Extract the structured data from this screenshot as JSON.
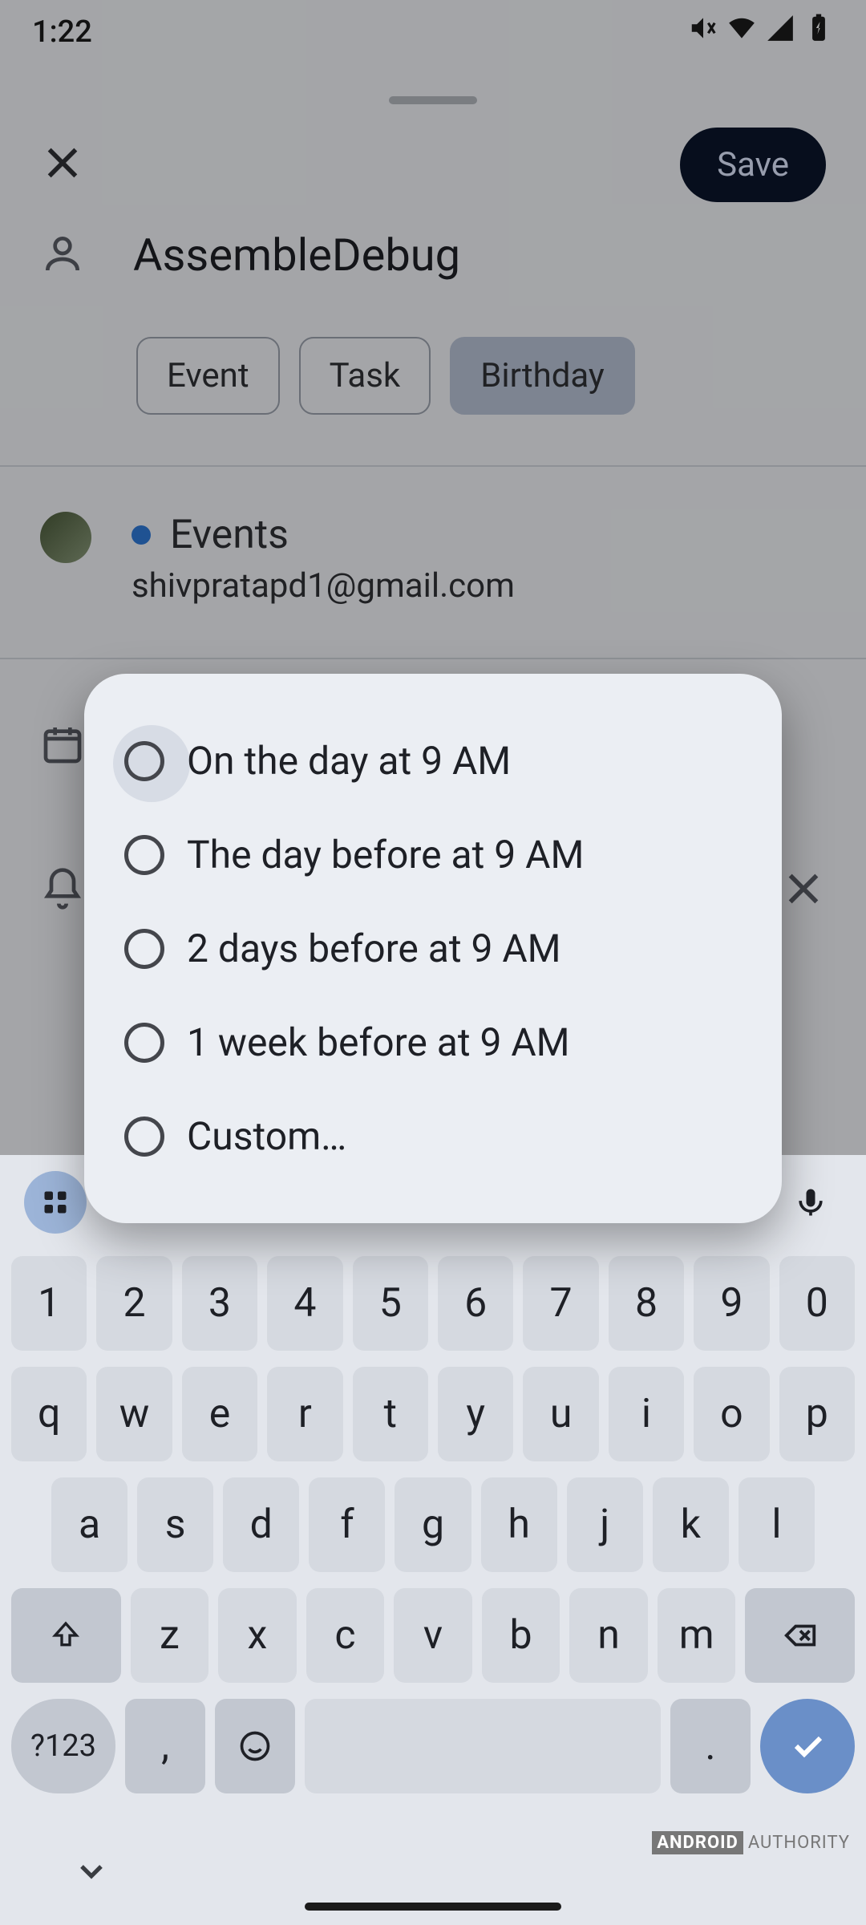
{
  "status": {
    "time": "1:22"
  },
  "topbar": {
    "save": "Save"
  },
  "title": "AssembleDebug",
  "chips": {
    "event": "Event",
    "task": "Task",
    "birthday": "Birthday"
  },
  "calendar": {
    "name": "Events",
    "email": "shivpratapd1@gmail.com"
  },
  "dialog": {
    "options": [
      "On the day at 9 AM",
      "The day before at 9 AM",
      "2 days before at 9 AM",
      "1 week before at 9 AM",
      "Custom…"
    ]
  },
  "keyboard": {
    "row_num": [
      "1",
      "2",
      "3",
      "4",
      "5",
      "6",
      "7",
      "8",
      "9",
      "0"
    ],
    "row1": [
      "q",
      "w",
      "e",
      "r",
      "t",
      "y",
      "u",
      "i",
      "o",
      "p"
    ],
    "row2": [
      "a",
      "s",
      "d",
      "f",
      "g",
      "h",
      "j",
      "k",
      "l"
    ],
    "row3": [
      "z",
      "x",
      "c",
      "v",
      "b",
      "n",
      "m"
    ],
    "sym": "?123",
    "comma": ",",
    "period": "."
  },
  "watermark": {
    "a": "ANDROID",
    "b": "AUTHORITY"
  }
}
